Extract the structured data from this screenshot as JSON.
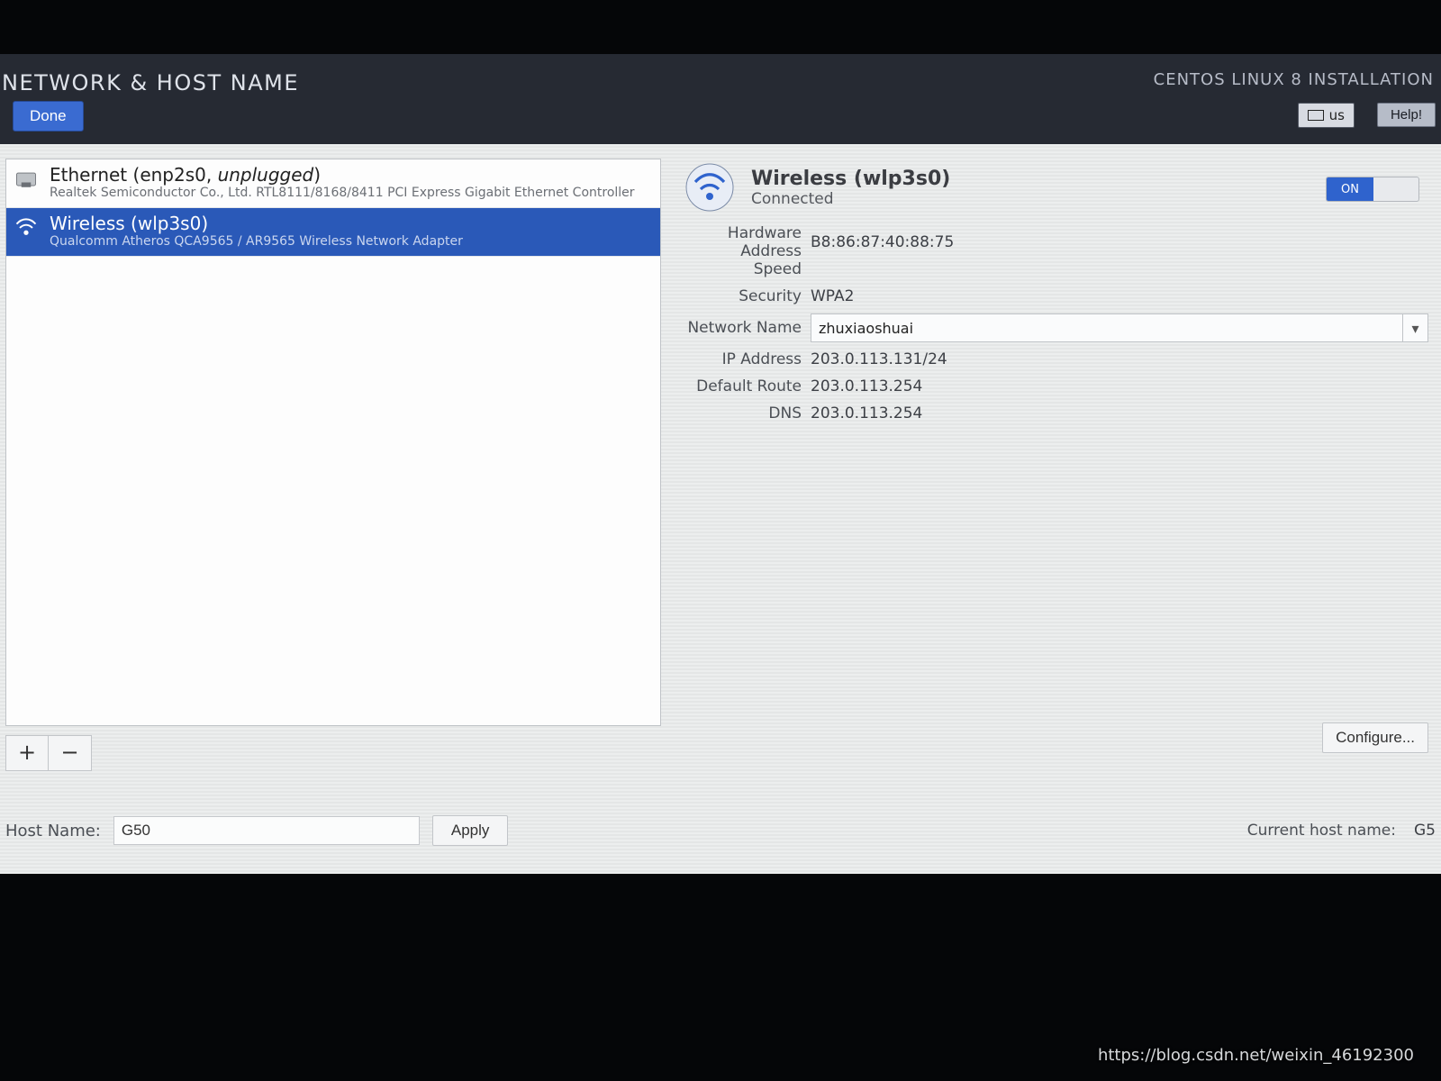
{
  "header": {
    "title": "NETWORK & HOST NAME",
    "done_label": "Done",
    "installer": "CENTOS LINUX 8 INSTALLATION",
    "keyboard": "us",
    "help_label": "Help!"
  },
  "devices": [
    {
      "icon": "ethernet-icon",
      "line1_pre": "Ethernet (enp2s0, ",
      "line1_em": "unplugged",
      "line1_post": ")",
      "line2": "Realtek Semiconductor Co., Ltd. RTL8111/8168/8411 PCI Express Gigabit Ethernet Controller",
      "selected": false
    },
    {
      "icon": "wireless-icon",
      "line1_pre": "Wireless (wlp3s0)",
      "line1_em": "",
      "line1_post": "",
      "line2": "Qualcomm Atheros QCA9565 / AR9565 Wireless Network Adapter",
      "selected": true
    }
  ],
  "list_buttons": {
    "add": "+",
    "remove": "−"
  },
  "detail": {
    "name": "Wireless (wlp3s0)",
    "status": "Connected",
    "toggle_on": "ON",
    "labels": {
      "hw": "Hardware Address",
      "speed": "Speed",
      "security": "Security",
      "netname": "Network Name",
      "ip": "IP Address",
      "route": "Default Route",
      "dns": "DNS"
    },
    "values": {
      "hw": "B8:86:87:40:88:75",
      "speed": "",
      "security": "WPA2",
      "netname": "zhuxiaoshuai",
      "ip": "203.0.113.131/24",
      "route": "203.0.113.254",
      "dns": "203.0.113.254"
    },
    "configure_label": "Configure..."
  },
  "hostname": {
    "label": "Host Name:",
    "value": "G50",
    "apply_label": "Apply",
    "current_label": "Current host name:",
    "current_value": "G5"
  },
  "watermark": "https://blog.csdn.net/weixin_46192300"
}
